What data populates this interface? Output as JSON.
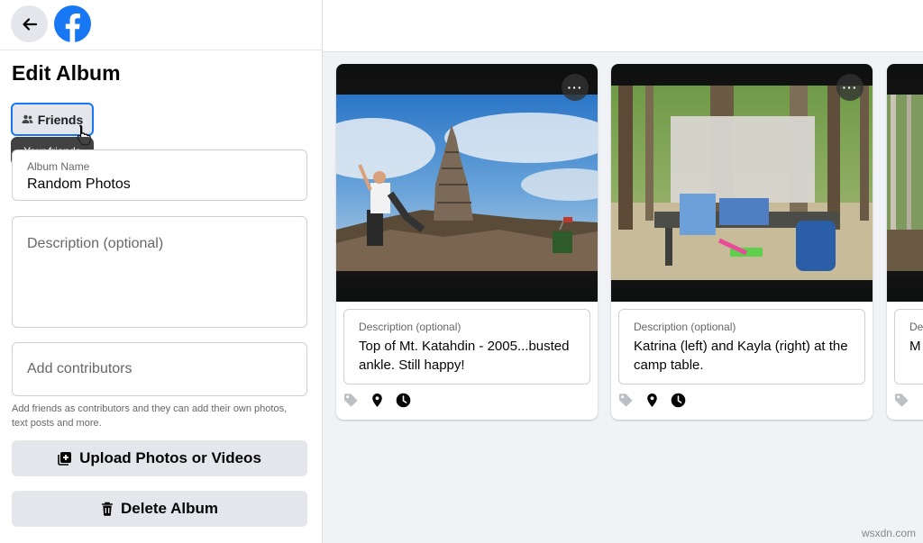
{
  "sidebar": {
    "title": "Edit Album",
    "audience": {
      "label": "Friends",
      "tooltip": "Your friends"
    },
    "album_name": {
      "label": "Album Name",
      "value": "Random Photos"
    },
    "description": {
      "placeholder": "Description (optional)"
    },
    "contributors": {
      "placeholder": "Add contributors",
      "help": "Add friends as contributors and they can add their own photos, text posts and more."
    },
    "upload_button": "Upload Photos or Videos",
    "delete_button": "Delete Album"
  },
  "photos": [
    {
      "description_label": "Description (optional)",
      "description": "Top of Mt. Katahdin - 2005...busted ankle.  Still happy!",
      "more_label": "···"
    },
    {
      "description_label": "Description (optional)",
      "description": "Katrina (left) and Kayla (right) at the camp table.",
      "more_label": "···"
    },
    {
      "description_label": "De",
      "description": "M Ap"
    }
  ],
  "icons": [
    "back-arrow-icon",
    "facebook-logo-icon",
    "friends-icon",
    "pointer-cursor-icon",
    "add-media-icon",
    "trash-icon",
    "tag-icon",
    "location-pin-icon",
    "clock-icon",
    "more-icon"
  ],
  "colors": {
    "brand": "#1877f2",
    "button_bg": "#e4e6eb",
    "page_bg": "#f0f2f5",
    "secondary_text": "#65676b"
  },
  "watermark": "wsxdn.com"
}
